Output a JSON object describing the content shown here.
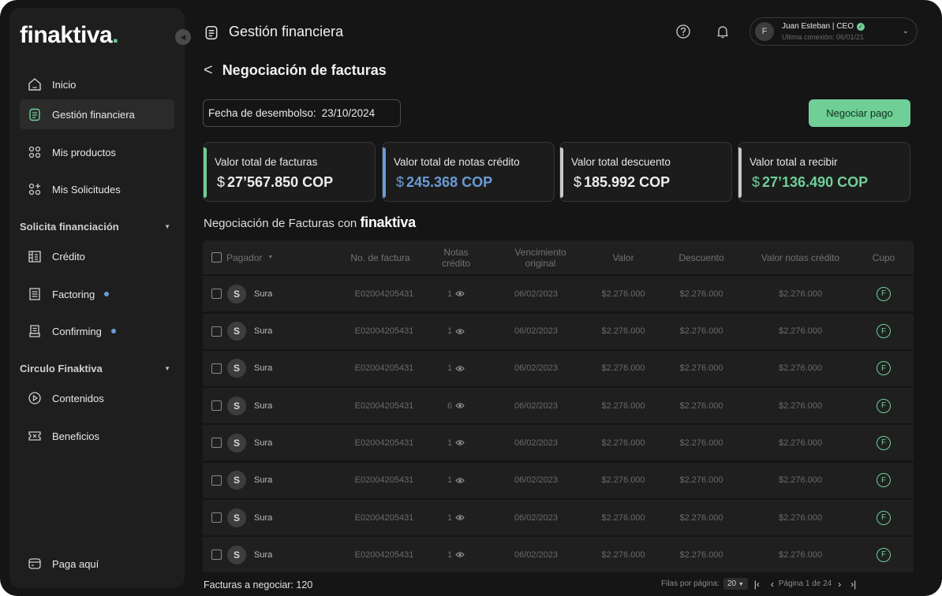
{
  "brand": {
    "name": "finaktiva",
    "dot": "."
  },
  "sidebar": {
    "items": [
      {
        "label": "Inicio",
        "icon": "home-icon"
      },
      {
        "label": "Gestión financiera",
        "icon": "clipboard-icon",
        "active": true
      },
      {
        "label": "Mis productos",
        "icon": "grid-icon"
      },
      {
        "label": "Mis Solicitudes",
        "icon": "grid-plus-icon"
      }
    ],
    "section1": {
      "label": "Solicita financiación"
    },
    "items2": [
      {
        "label": "Crédito",
        "icon": "building-icon"
      },
      {
        "label": "Factoring",
        "icon": "document-icon"
      },
      {
        "label": "Confirming",
        "icon": "receipt-icon"
      }
    ],
    "section2": {
      "label": "Circulo Finaktiva"
    },
    "items3": [
      {
        "label": "Contenidos",
        "icon": "play-icon"
      },
      {
        "label": "Beneficios",
        "icon": "ticket-icon"
      }
    ],
    "bottom": {
      "label": "Paga aquí",
      "icon": "wallet-icon"
    }
  },
  "header": {
    "title": "Gestión financiera",
    "user": {
      "initial": "F",
      "name": "Juan Esteban | CEO",
      "last_login": "Ultima conexión: 06/01/21"
    }
  },
  "page": {
    "title": "Negociación de facturas",
    "date_label": "Fecha de desembolso:",
    "date_value": "23/10/2024",
    "negotiate_button": "Negociar pago"
  },
  "cards": [
    {
      "label": "Valor total de facturas",
      "currency": "$",
      "value": "27’567.850 COP",
      "accent": "#6fcf97",
      "value_color": "#eeeeee"
    },
    {
      "label": "Valor total de notas crédito",
      "currency": "$",
      "value": "245.368 COP",
      "accent": "#6a9cd6",
      "value_color": "#6a9cd6"
    },
    {
      "label": "Valor total descuento",
      "currency": "$",
      "value": "185.992 COP",
      "accent": "#c9c9c9",
      "value_color": "#eeeeee"
    },
    {
      "label": "Valor total a recibir",
      "currency": "$",
      "value": "27’136.490 COP",
      "accent": "#c9c9c9",
      "value_color": "#6fcf97"
    }
  ],
  "table": {
    "title_prefix": "Negociación de Facturas con",
    "title_brand": "finaktiva",
    "columns": {
      "pagador": "Pagador",
      "no_factura": "No. de factura",
      "notas_credito": "Notas crédito",
      "vencimiento": "Vencimiento original",
      "valor": "Valor",
      "descuento": "Descuento",
      "valor_notas": "Valor notas crédito",
      "cupo": "Cupo"
    },
    "rows": [
      {
        "initial": "S",
        "payer": "Sura",
        "invoice": "E02004205431",
        "notes": "1",
        "due": "06/02/2023",
        "value": "$2.276.000",
        "discount": "$2.276.000",
        "notes_value": "$2.276.000",
        "cupo": "F"
      },
      {
        "initial": "S",
        "payer": "Sura",
        "invoice": "E02004205431",
        "notes": "1",
        "due": "06/02/2023",
        "value": "$2.276.000",
        "discount": "$2.276.000",
        "notes_value": "$2.276.000",
        "cupo": "F"
      },
      {
        "initial": "S",
        "payer": "Sura",
        "invoice": "E02004205431",
        "notes": "1",
        "due": "06/02/2023",
        "value": "$2.276.000",
        "discount": "$2.276.000",
        "notes_value": "$2.276.000",
        "cupo": "F"
      },
      {
        "initial": "S",
        "payer": "Sura",
        "invoice": "E02004205431",
        "notes": "6",
        "due": "06/02/2023",
        "value": "$2.276.000",
        "discount": "$2.276.000",
        "notes_value": "$2.276.000",
        "cupo": "F"
      },
      {
        "initial": "S",
        "payer": "Sura",
        "invoice": "E02004205431",
        "notes": "1",
        "due": "06/02/2023",
        "value": "$2.276.000",
        "discount": "$2.276.000",
        "notes_value": "$2.276.000",
        "cupo": "F"
      },
      {
        "initial": "S",
        "payer": "Sura",
        "invoice": "E02004205431",
        "notes": "1",
        "due": "06/02/2023",
        "value": "$2.276.000",
        "discount": "$2.276.000",
        "notes_value": "$2.276.000",
        "cupo": "F"
      },
      {
        "initial": "S",
        "payer": "Sura",
        "invoice": "E02004205431",
        "notes": "1",
        "due": "06/02/2023",
        "value": "$2.276.000",
        "discount": "$2.276.000",
        "notes_value": "$2.276.000",
        "cupo": "F"
      },
      {
        "initial": "S",
        "payer": "Sura",
        "invoice": "E02004205431",
        "notes": "1",
        "due": "06/02/2023",
        "value": "$2.276.000",
        "discount": "$2.276.000",
        "notes_value": "$2.276.000",
        "cupo": "F"
      }
    ]
  },
  "footer": {
    "count_label": "Facturas a negociar: 120",
    "rows_label": "Filas por página:",
    "rows_value": "20",
    "page_label": "Página 1 de 24"
  }
}
